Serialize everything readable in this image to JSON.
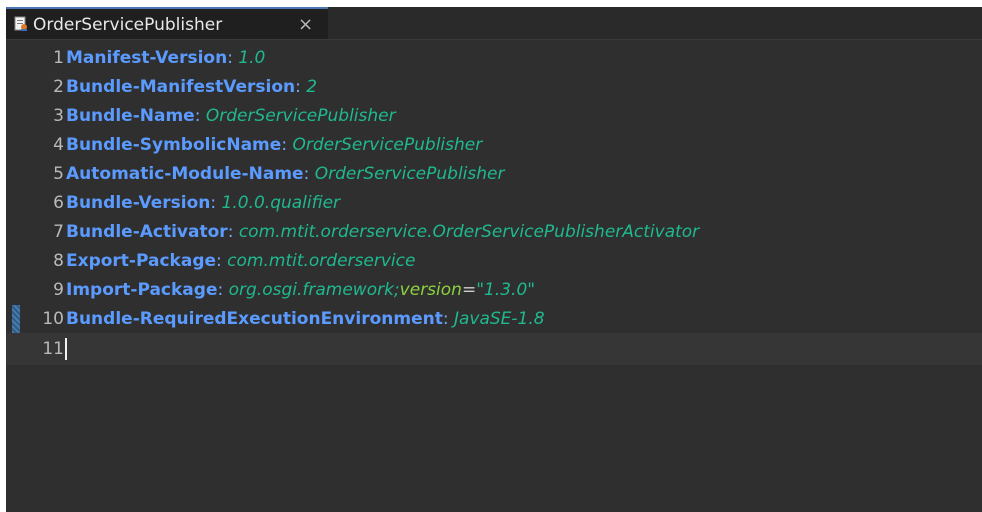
{
  "tab": {
    "title": "OrderServicePublisher",
    "close": "×"
  },
  "lines": [
    {
      "num": "1",
      "key": "Manifest-Version",
      "sep": ":",
      "value": "1.0"
    },
    {
      "num": "2",
      "key": "Bundle-ManifestVersion",
      "sep": ":",
      "value": "2"
    },
    {
      "num": "3",
      "key": "Bundle-Name",
      "sep": ":",
      "value": "OrderServicePublisher"
    },
    {
      "num": "4",
      "key": "Bundle-SymbolicName",
      "sep": ":",
      "value": "OrderServicePublisher"
    },
    {
      "num": "5",
      "key": "Automatic-Module-Name",
      "sep": ":",
      "value": "OrderServicePublisher"
    },
    {
      "num": "6",
      "key": "Bundle-Version",
      "sep": ":",
      "value": "1.0.0.qualifier"
    },
    {
      "num": "7",
      "key": "Bundle-Activator",
      "sep": ":",
      "value": "com.mtit.orderservice.OrderServicePublisherActivator"
    },
    {
      "num": "8",
      "key": "Export-Package",
      "sep": ":",
      "value": "com.mtit.orderservice"
    },
    {
      "num": "9",
      "key": "Import-Package",
      "sep": ":",
      "value": "org.osgi.framework;",
      "attr": "version",
      "eq": "=",
      "quoted": "\"1.3.0\""
    },
    {
      "num": "10",
      "key": "Bundle-RequiredExecutionEnvironment",
      "sep": ":",
      "value": "JavaSE-1.8"
    },
    {
      "num": "11"
    }
  ],
  "colors": {
    "background": "#2f2f2f",
    "key": "#5b9bff",
    "value": "#1fb98f",
    "attribute": "#8cd23f",
    "line_number": "#b9b9b9",
    "tab_accent": "#4a74b4"
  }
}
